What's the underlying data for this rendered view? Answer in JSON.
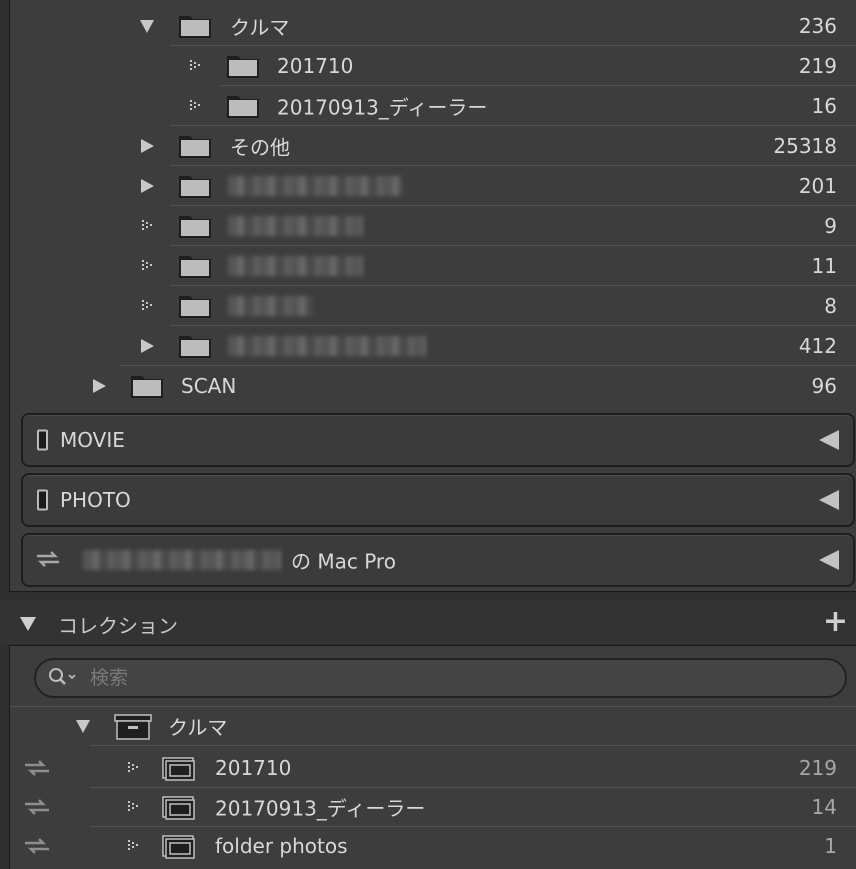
{
  "folders": [
    {
      "label": "クルマ",
      "count": "236",
      "state": "expanded"
    },
    {
      "label": "201710",
      "count": "219",
      "state": "leaf"
    },
    {
      "label": "20170913_ディーラー",
      "count": "16",
      "state": "leaf"
    },
    {
      "label": "その他",
      "count": "25318",
      "state": "collapsed"
    },
    {
      "label": "",
      "count": "201",
      "state": "collapsed"
    },
    {
      "label": "",
      "count": "9",
      "state": "leaf"
    },
    {
      "label": "",
      "count": "11",
      "state": "leaf"
    },
    {
      "label": "",
      "count": "8",
      "state": "leaf"
    },
    {
      "label": "",
      "count": "412",
      "state": "collapsed"
    },
    {
      "label": "SCAN",
      "count": "96",
      "state": "collapsed"
    }
  ],
  "volumes": [
    {
      "label": "MOVIE"
    },
    {
      "label": "PHOTO"
    },
    {
      "label": "の Mac Pro"
    }
  ],
  "collections": {
    "header": "コレクション",
    "add": "+",
    "search_placeholder": "検索",
    "set_label": "クルマ",
    "items": [
      {
        "label": "201710",
        "count": "219"
      },
      {
        "label": "20170913_ディーラー",
        "count": "14"
      },
      {
        "label": "folder photos",
        "count": "1"
      }
    ]
  },
  "colors": {
    "panel": "#3d3d3d",
    "text": "#d8d8d8",
    "separator": "#525252"
  }
}
